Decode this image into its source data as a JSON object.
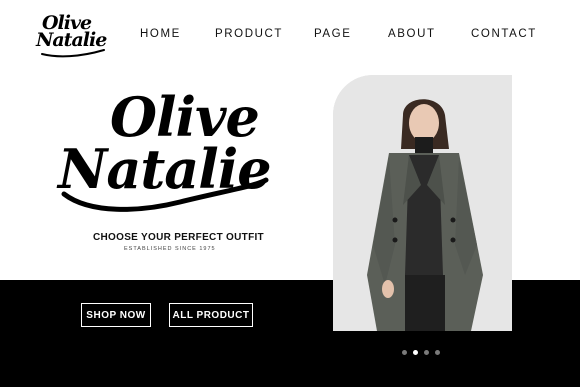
{
  "brand": {
    "logo_line1": "Olive",
    "logo_line2": "Natalie"
  },
  "nav": {
    "items": [
      {
        "label": "HOME"
      },
      {
        "label": "PRODUCT"
      },
      {
        "label": "PAGE"
      },
      {
        "label": "ABOUT"
      },
      {
        "label": "CONTACT"
      }
    ]
  },
  "hero": {
    "title_line1": "Olive",
    "title_line2": "Natalie",
    "tagline": "CHOOSE YOUR PERFECT OUTFIT",
    "established": "ESTABLISHED SINCE 1975",
    "shop_button": "SHOP NOW",
    "all_button": "ALL PRODUCT"
  },
  "carousel": {
    "count": 4,
    "active_index": 1
  },
  "colors": {
    "background_top": "#ffffff",
    "background_bottom": "#000000",
    "text": "#111111",
    "photo_bg": "#e4e4e4",
    "coat": "#5b5f58"
  }
}
